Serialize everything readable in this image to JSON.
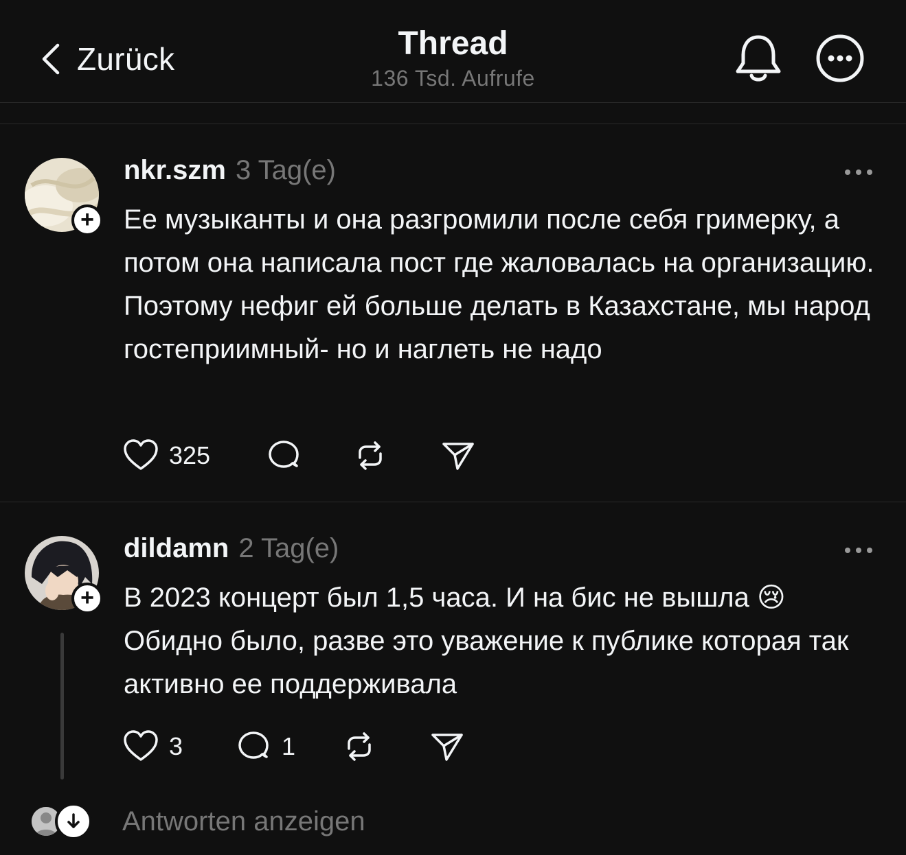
{
  "header": {
    "back_label": "Zurück",
    "title": "Thread",
    "views": "136 Tsd. Aufrufe"
  },
  "posts": [
    {
      "username": "nkr.szm",
      "time": "3 Tag(e)",
      "text": "Ее музыканты и она разгромили после себя гримерку, а потом она написала пост где жаловалась на организацию. Поэтому нефиг ей больше делать в Казахстане, мы народ гостеприимный- но и наглеть не надо",
      "likes": "325",
      "replies": ""
    },
    {
      "username": "dildamn",
      "time": "2 Tag(e)",
      "text_before_emoji": "В 2023 концерт был 1,5 часа. И на бис не вышла",
      "emoji": "😢",
      "text_after_emoji": "Обидно было, разве это уважение к публике которая так активно ее поддерживала",
      "likes": "3",
      "replies": "1"
    }
  ],
  "show_replies_label": "Antworten anzeigen",
  "icons": {
    "back": "chevron-left-icon",
    "bell": "bell-icon",
    "more": "more-circle-icon",
    "like": "heart-icon",
    "comment": "comment-icon",
    "repost": "repost-icon",
    "share": "send-icon",
    "follow": "plus-icon",
    "arrow_down": "arrow-down-icon"
  },
  "colors": {
    "background": "#101010",
    "text": "#f3f5f7",
    "secondary_text": "#777777",
    "divider": "#2a2a2a"
  }
}
